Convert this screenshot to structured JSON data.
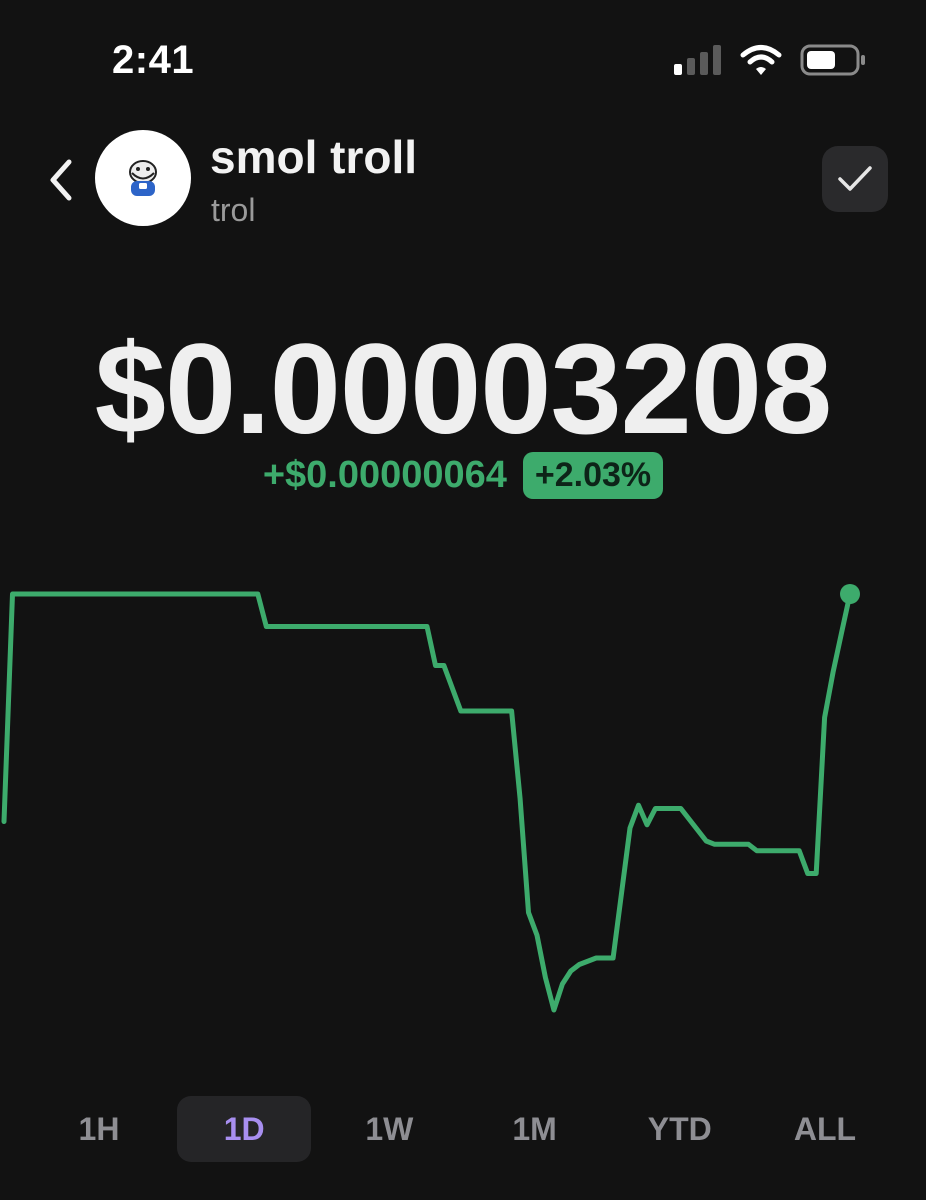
{
  "status_bar": {
    "time": "2:41",
    "icons": [
      "cellular-signal-icon",
      "wifi-icon",
      "battery-icon"
    ]
  },
  "header": {
    "back_icon": "chevron-left-icon",
    "avatar_icon": "troll-face-icon",
    "token_name": "smol troll",
    "token_symbol": "trol",
    "watch_icon": "checkmark-icon"
  },
  "price": {
    "current": "$0.00003208",
    "change_abs": "+$0.00000064",
    "change_pct": "+2.03%"
  },
  "colors": {
    "background": "#121212",
    "positive": "#3dab6c",
    "active_tab": "#a88ff0",
    "muted_text": "#8e8e93"
  },
  "chart_data": {
    "type": "line",
    "style": "step",
    "color": "#3dab6c",
    "grid": false,
    "series": [
      {
        "x": [
          0,
          1,
          2,
          30,
          31,
          32,
          50,
          51,
          52,
          54,
          55,
          60,
          61,
          62,
          63,
          64,
          65,
          66,
          67,
          68,
          70,
          72,
          74,
          75,
          76,
          77,
          78,
          80,
          83,
          84,
          88,
          89,
          94,
          95,
          96,
          97,
          98,
          99,
          100
        ],
        "values": [
          3.138e-05,
          3.208e-05,
          3.208e-05,
          3.208e-05,
          3.198e-05,
          3.198e-05,
          3.198e-05,
          3.186e-05,
          3.186e-05,
          3.172e-05,
          3.172e-05,
          3.172e-05,
          3.145e-05,
          3.11e-05,
          3.103e-05,
          3.09e-05,
          3.08e-05,
          3.088e-05,
          3.092e-05,
          3.094e-05,
          3.096e-05,
          3.096e-05,
          3.136e-05,
          3.143e-05,
          3.137e-05,
          3.142e-05,
          3.142e-05,
          3.142e-05,
          3.132e-05,
          3.131e-05,
          3.131e-05,
          3.129e-05,
          3.129e-05,
          3.122e-05,
          3.122e-05,
          3.17e-05,
          3.184e-05,
          3.196e-05,
          3.208e-05
        ]
      }
    ]
  },
  "range_tabs": [
    {
      "label": "1H",
      "active": false
    },
    {
      "label": "1D",
      "active": true
    },
    {
      "label": "1W",
      "active": false
    },
    {
      "label": "1M",
      "active": false
    },
    {
      "label": "YTD",
      "active": false
    },
    {
      "label": "ALL",
      "active": false
    }
  ]
}
